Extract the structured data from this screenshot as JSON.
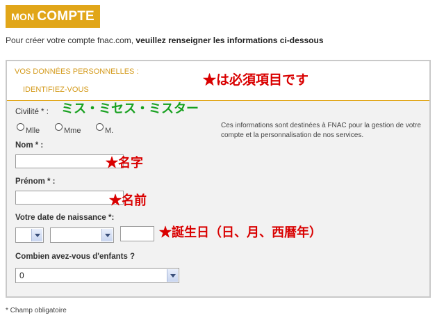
{
  "header": {
    "title_prefix": "MON",
    "title_main": "COMPTE"
  },
  "intro": {
    "text_plain": "Pour créer votre compte fnac.com, ",
    "text_bold": "veuillez renseigner les informations ci-dessous"
  },
  "section": {
    "title": "VOS DONNÉES PERSONNELLES :",
    "subtitle": "IDENTIFIEZ-VOUS"
  },
  "form": {
    "civility_label": "Civilité * :",
    "civility_options": [
      "Mlle",
      "Mme",
      "M."
    ],
    "name_label": "Nom * :",
    "firstname_label": "Prénom * :",
    "birthdate_label": "Votre date de naissance *:",
    "children_label": "Combien avez-vous d'enfants ?",
    "children_value": "0"
  },
  "info_text": "Ces informations sont destinées à FNAC pour la gestion de votre compte et la personnalisation de nos services.",
  "annotations": {
    "required_note": "★は必須項目です",
    "civility_note": "ミス・ミセス・ミスター",
    "name_note": "★名字",
    "firstname_note": "★名前",
    "birthdate_note": "★誕生日（日、月、西暦年）"
  },
  "footnote": "* Champ obligatoire",
  "colors": {
    "accent": "#e1a619",
    "annotation_red": "#d90000",
    "annotation_green": "#16a01e"
  }
}
